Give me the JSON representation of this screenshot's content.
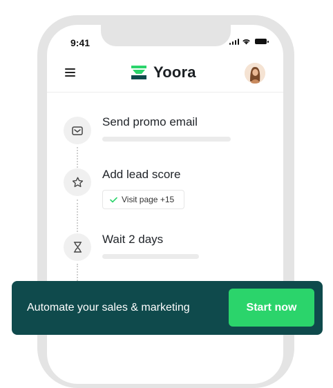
{
  "status_bar": {
    "time": "9:41"
  },
  "nav": {
    "brand_name": "Yoora",
    "brand_color": "#0f4a4c",
    "brand_accent": "#2bd46b",
    "menu_icon": "hamburger-menu-icon",
    "avatar": "user-avatar"
  },
  "workflow": {
    "steps": [
      {
        "title": "Send promo email",
        "icon": "envelope-icon"
      },
      {
        "title": "Add lead score",
        "icon": "star-icon",
        "tag": {
          "icon": "checkmark-icon",
          "label": "Visit page +15"
        }
      },
      {
        "title": "Wait 2 days",
        "icon": "hourglass-icon"
      }
    ]
  },
  "cta": {
    "text": "Automate your sales & marketing",
    "button_label": "Start now",
    "background": "#0f4a4c",
    "button_color": "#2bd46b"
  }
}
